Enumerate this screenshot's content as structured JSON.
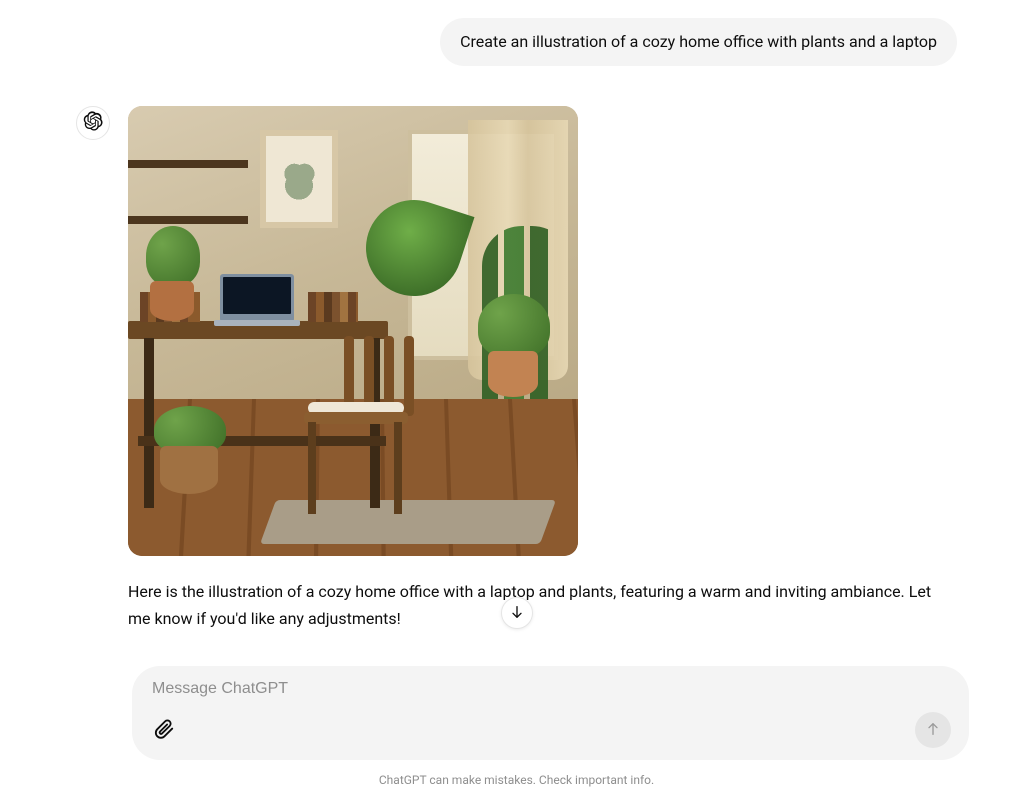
{
  "user_message": "Create an illustration of a cozy home office with plants and a laptop",
  "assistant_message": "Here is the illustration of a cozy home office with a laptop and plants, featuring a warm and inviting ambiance. Let me know if you'd like any adjustments!",
  "input": {
    "placeholder": "Message ChatGPT"
  },
  "disclaimer": "ChatGPT can make mistakes. Check important info.",
  "image_alt": "Illustration of a cozy home office with a wooden desk, laptop, chair, many potted plants, curtains and warm lighting"
}
